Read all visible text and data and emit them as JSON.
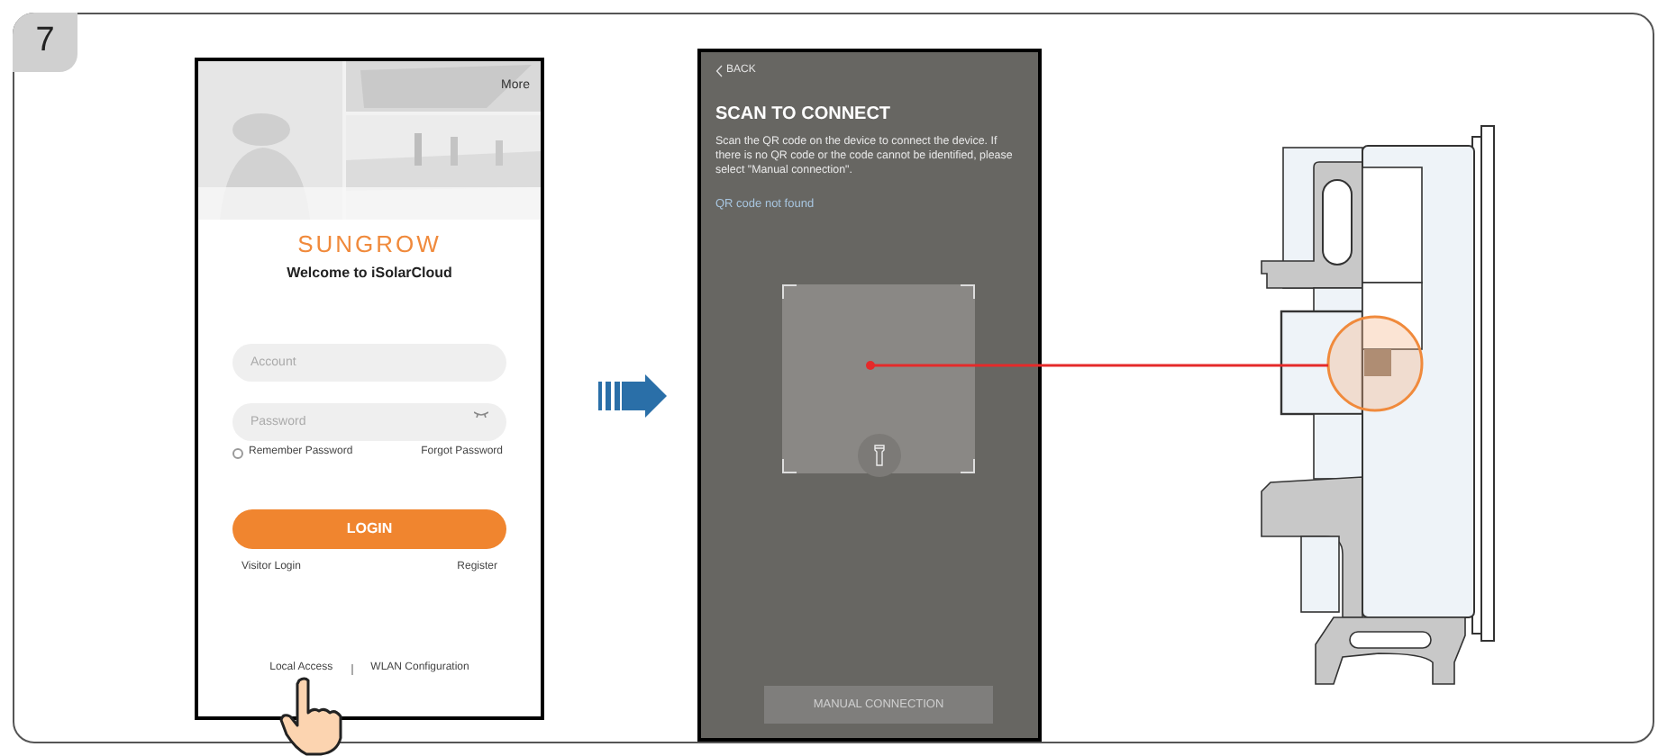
{
  "step": "7",
  "login_screen": {
    "header_link": "More",
    "logo": "SUNGROW",
    "welcome": "Welcome to iSolarCloud",
    "account_field": {
      "placeholder": "Account"
    },
    "password_field": {
      "placeholder": "Password"
    },
    "remember_password": {
      "label": "Remember Password",
      "checked": false
    },
    "forgot_password": "Forgot Password",
    "login_button": "LOGIN",
    "visitor_login": "Visitor Login",
    "register": "Register",
    "footer_links": [
      "Local Access",
      "WLAN Configuration"
    ]
  },
  "scan_screen": {
    "back": "BACK",
    "title": "SCAN TO CONNECT",
    "instructions": "Scan the QR code on the device to connect the device. If there is no QR code or the code cannot be identified, please select \"Manual connection\".",
    "link": "QR code not found",
    "button": "MANUAL CONNECTION"
  }
}
